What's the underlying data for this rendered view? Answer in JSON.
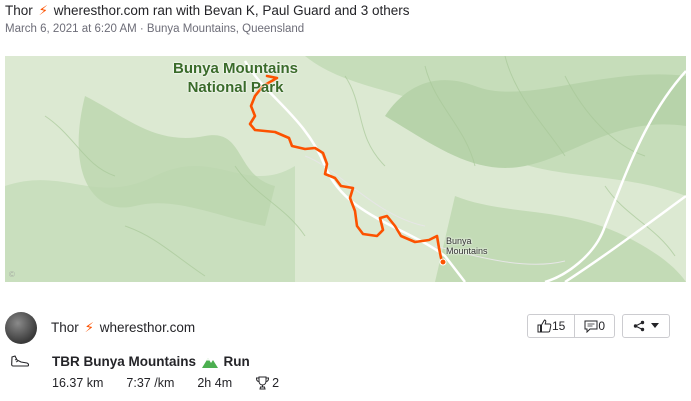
{
  "header": {
    "athlete": "Thor",
    "handle_text": "wheresthor.com ran with Bevan K, Paul Guard and 3 others",
    "subtitle": "March 6, 2021 at 6:20 AM · Bunya Mountains, Queensland"
  },
  "map": {
    "park_label_line1": "Bunya Mountains",
    "park_label_line2": "National Park",
    "town_label_line1": "Bunya",
    "town_label_line2": "Mountains",
    "route_color": "#fc5200"
  },
  "athlete": {
    "name": "Thor",
    "handle": "wheresthor.com"
  },
  "actions": {
    "kudos_count": "15",
    "comment_count": "0"
  },
  "activity": {
    "title": "TBR Bunya Mountains",
    "type": "Run",
    "distance": "16.37 km",
    "pace": "7:37 /km",
    "time": "2h 4m",
    "achievements": "2"
  },
  "colors": {
    "accent": "#fc5200",
    "text": "#242428",
    "muted": "#6d6d78"
  }
}
